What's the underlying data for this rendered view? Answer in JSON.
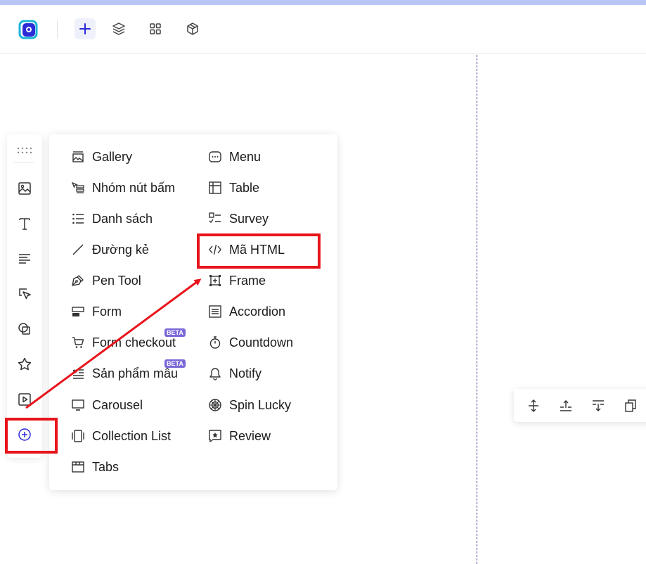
{
  "toolbar": {
    "logo_icon": "app-logo",
    "buttons": [
      "plus-icon",
      "layers-icon",
      "grid-icon",
      "box-icon"
    ],
    "accent": "#2b2bd8"
  },
  "sidebar": {
    "items": [
      "image-icon",
      "text-icon",
      "paragraph-icon",
      "button-icon",
      "shape-icon",
      "star-icon",
      "video-icon",
      "add-circle-icon"
    ]
  },
  "menu": {
    "left": [
      {
        "label": "Gallery",
        "icon": "gallery-icon"
      },
      {
        "label": "Nhóm nút bấm",
        "icon": "button-group-icon"
      },
      {
        "label": "Danh sách",
        "icon": "list-icon"
      },
      {
        "label": "Đường kẻ",
        "icon": "line-icon"
      },
      {
        "label": "Pen Tool",
        "icon": "pen-tool-icon"
      },
      {
        "label": "Form",
        "icon": "form-icon"
      },
      {
        "label": "Form checkout",
        "icon": "cart-icon",
        "badge": "BETA"
      },
      {
        "label": "Sản phẩm mẫu",
        "icon": "product-icon",
        "badge": "BETA"
      },
      {
        "label": "Carousel",
        "icon": "carousel-icon"
      },
      {
        "label": "Collection List",
        "icon": "collection-icon"
      },
      {
        "label": "Tabs",
        "icon": "tabs-icon"
      }
    ],
    "right": [
      {
        "label": "Menu",
        "icon": "menu-icon"
      },
      {
        "label": "Table",
        "icon": "table-icon"
      },
      {
        "label": "Survey",
        "icon": "survey-icon"
      },
      {
        "label": "Mã HTML",
        "icon": "code-icon"
      },
      {
        "label": "Frame",
        "icon": "frame-icon"
      },
      {
        "label": "Accordion",
        "icon": "accordion-icon"
      },
      {
        "label": "Countdown",
        "icon": "timer-icon"
      },
      {
        "label": "Notify",
        "icon": "bell-icon"
      },
      {
        "label": "Spin Lucky",
        "icon": "spin-icon"
      },
      {
        "label": "Review",
        "icon": "review-icon"
      }
    ]
  },
  "annotation": {
    "color": "#e8141b"
  },
  "floating_toolbar": {
    "buttons": [
      "move-vertical-icon",
      "insert-above-icon",
      "insert-below-icon",
      "duplicate-icon"
    ]
  }
}
